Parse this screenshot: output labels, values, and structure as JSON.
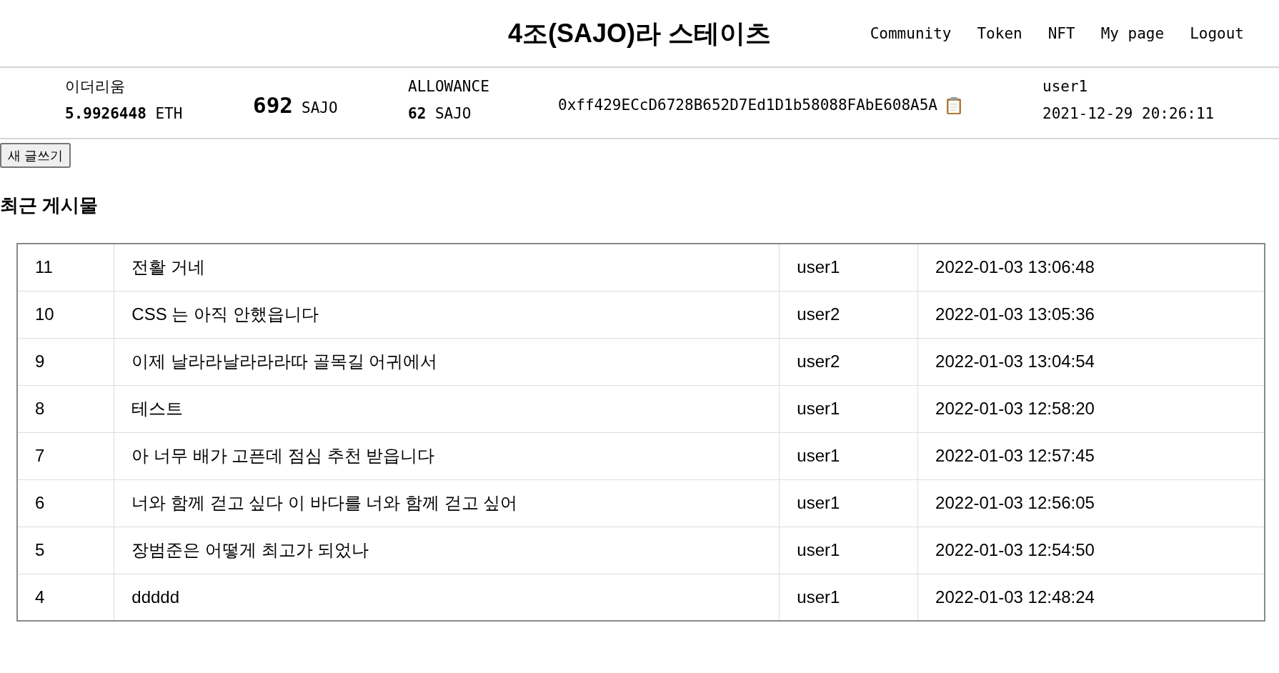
{
  "header": {
    "title": "4조(SAJO)라 스테이츠",
    "nav": [
      "Community",
      "Token",
      "NFT",
      "My page",
      "Logout"
    ]
  },
  "wallet": {
    "eth": {
      "label": "이더리움",
      "value": "**5.9926448** ETH"
    },
    "token": {
      "amount": "692",
      "unit": "SAJO"
    },
    "allowance": {
      "label": "ALLOWANCE",
      "value": "**62** SAJO"
    },
    "address": "0xff429ECcD6728B652D7Ed1D1b58088FAbE608A5A",
    "user": {
      "name": "user1",
      "timestamp": "2021-12-29 20:26:11"
    }
  },
  "new_post_button": "새 글쓰기",
  "recent_posts": {
    "heading": "최근 게시물",
    "rows": [
      [
        "11",
        "전활 거네",
        "user1",
        "2022-01-03 13:06:48"
      ],
      [
        "10",
        "CSS 는 아직 안했읍니다",
        "user2",
        "2022-01-03 13:05:36"
      ],
      [
        "9",
        "이제 날라라날라라라따 골목길 어귀에서",
        "user2",
        "2022-01-03 13:04:54"
      ],
      [
        "8",
        "테스트",
        "user1",
        "2022-01-03 12:58:20"
      ],
      [
        "7",
        "아 너무 배가 고픈데 점심 추천 받읍니다",
        "user1",
        "2022-01-03 12:57:45"
      ],
      [
        "6",
        "너와 함께 걷고 싶다 이 바다를 너와 함께 걷고 싶어",
        "user1",
        "2022-01-03 12:56:05"
      ],
      [
        "5",
        "장범준은 어떻게 최고가 되었나",
        "user1",
        "2022-01-03 12:54:50"
      ],
      [
        "4",
        "ddddd",
        "user1",
        "2022-01-03 12:48:24"
      ]
    ]
  }
}
